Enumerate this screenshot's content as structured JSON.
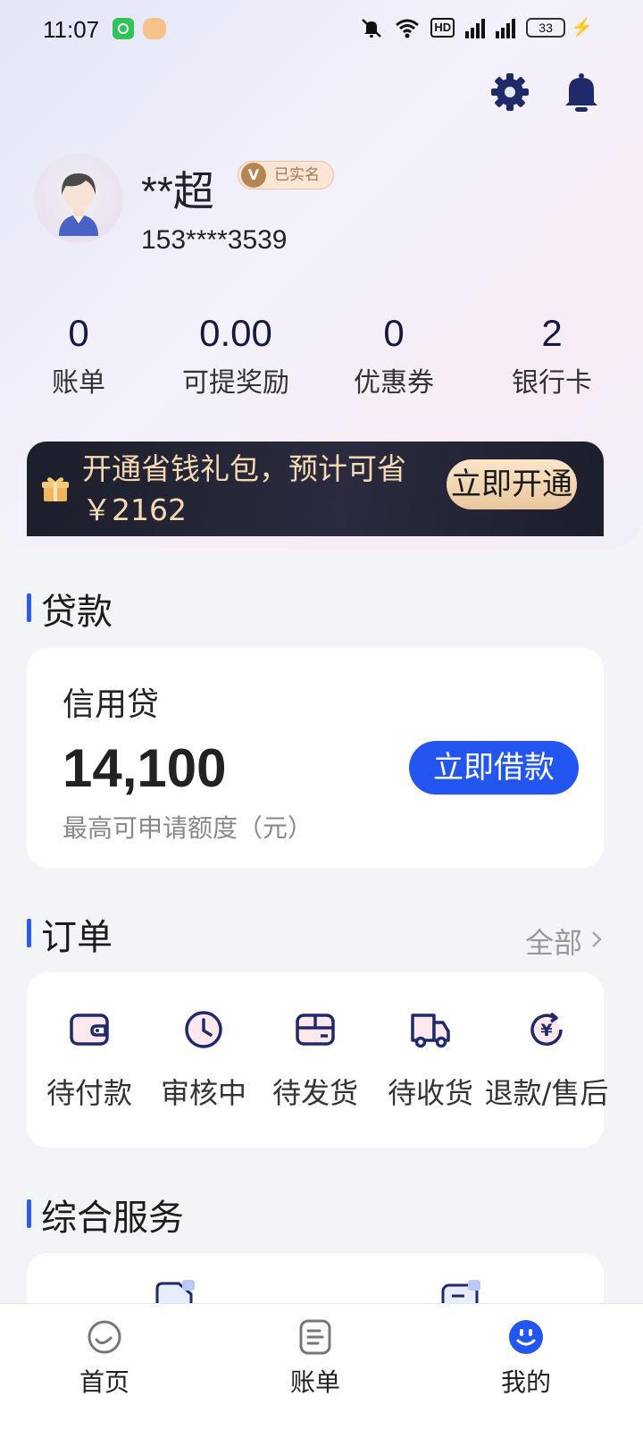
{
  "status_bar": {
    "time": "11:07",
    "network_label": "HD",
    "battery_level": "33"
  },
  "profile": {
    "name": "**超",
    "verified_badge_letter": "V",
    "verified_label": "已实名",
    "phone": "153****3539"
  },
  "stats": [
    {
      "value": "0",
      "label": "账单"
    },
    {
      "value": "0.00",
      "label": "可提奖励"
    },
    {
      "value": "0",
      "label": "优惠券"
    },
    {
      "value": "2",
      "label": "银行卡"
    }
  ],
  "banner": {
    "text": "开通省钱礼包，预计可省￥2162",
    "button": "立即开通"
  },
  "loan_section": {
    "title": "贷款",
    "product_name": "信用贷",
    "amount": "14,100",
    "amount_hint": "最高可申请额度（元）",
    "button": "立即借款"
  },
  "orders_section": {
    "title": "订单",
    "all_link": "全部",
    "items": [
      {
        "label": "待付款",
        "icon": "wallet-icon"
      },
      {
        "label": "审核中",
        "icon": "clock-icon"
      },
      {
        "label": "待发货",
        "icon": "package-icon"
      },
      {
        "label": "待收货",
        "icon": "truck-icon"
      },
      {
        "label": "退款/售后",
        "icon": "refund-yuan-icon"
      }
    ]
  },
  "services_section": {
    "title": "综合服务"
  },
  "tabbar": [
    {
      "label": "首页",
      "icon": "home-icon"
    },
    {
      "label": "账单",
      "icon": "bill-icon"
    },
    {
      "label": "我的",
      "icon": "profile-smile-icon",
      "active": true
    }
  ],
  "colors": {
    "accent": "#2356f0",
    "banner_bg": "#1d1e2b",
    "banner_text": "#f6d9b2",
    "stat_number": "#151840"
  }
}
